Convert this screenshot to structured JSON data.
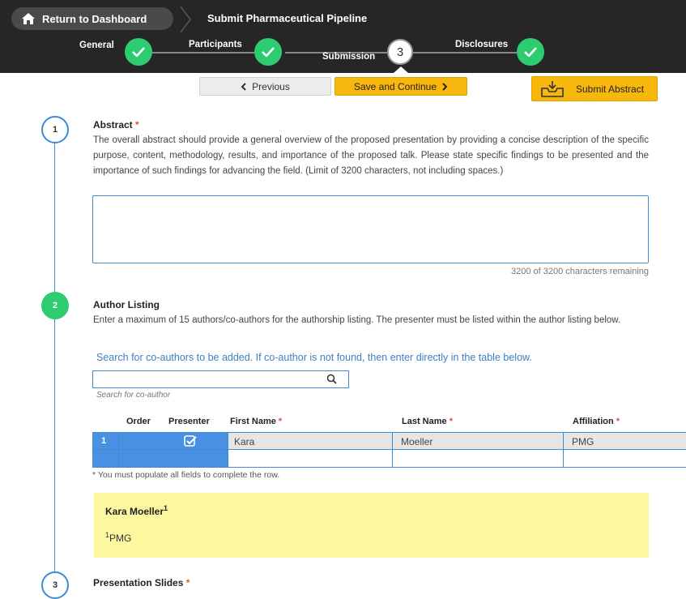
{
  "header": {
    "home_label": "Return to Dashboard",
    "page_title": "Submit Pharmaceutical Pipeline"
  },
  "steps": {
    "general": "General",
    "participants": "Participants",
    "submission": "Submission",
    "submission_number": "3",
    "disclosures": "Disclosures"
  },
  "actions": {
    "previous": "Previous",
    "save": "Save and Continue",
    "submit": "Submit Abstract"
  },
  "abstract": {
    "number": "1",
    "title": "Abstract",
    "required": "*",
    "description": "The overall abstract should provide a general overview of the proposed presentation by providing a concise description of the specific purpose, content, methodology, results, and importance of the proposed talk. Please state specific findings to be presented and the importance of such findings for advancing the field. (Limit of 3200 characters, not including spaces.)",
    "value": "",
    "char_count": "3200 of 3200 characters remaining"
  },
  "authors": {
    "number": "2",
    "title": "Author Listing",
    "description": "Enter a maximum of 15 authors/co-authors for the authorship listing. The presenter must be listed within the author listing below.",
    "search_note": "Search for co-authors to be added. If co-author is not found, then enter directly in the table below.",
    "search_value": "",
    "search_hint": "Search for co-author",
    "columns": {
      "order": "Order",
      "presenter": "Presenter",
      "first_name": "First Name",
      "last_name": "Last Name",
      "affiliation": "Affiliation",
      "required": "*"
    },
    "rows": [
      {
        "index": "1",
        "first_name": "Kara",
        "last_name": "Moeller",
        "affiliation": "PMG"
      }
    ],
    "row_note": "* You must populate all fields to complete the row.",
    "preview_name": "Kara Moeller",
    "preview_sup": "1",
    "preview_affiliation": "PMG"
  },
  "slides": {
    "number": "3",
    "title": "Presentation Slides",
    "required": "*"
  },
  "colors": {
    "accent_blue": "#3d8bd4",
    "success_green": "#2ecc71",
    "warning_yellow": "#f8b70c",
    "preview_bg": "#fbf8a0"
  }
}
